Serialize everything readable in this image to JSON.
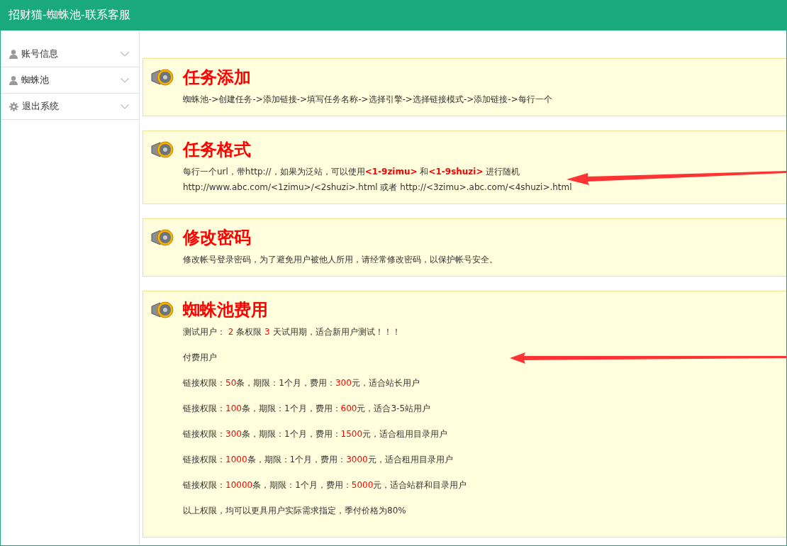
{
  "header": {
    "title": "招财猫-蜘蛛池-联系客服"
  },
  "sidebar": {
    "items": [
      {
        "label": "账号信息",
        "kind": "user",
        "expanded": false
      },
      {
        "label": "蜘蛛池",
        "kind": "user",
        "expanded": false
      },
      {
        "label": "退出系统",
        "kind": "gear",
        "expanded": false
      }
    ]
  },
  "notices": [
    {
      "title": "任务添加",
      "kind": "info",
      "paragraphs": [
        [
          {
            "text": "蜘蛛池->创建任务->添加链接->填写任务名称->选择引擎->选择链接模式->添加链接->每行一个",
            "kind": "plain"
          }
        ]
      ]
    },
    {
      "title": "任务格式",
      "kind": "info",
      "paragraphs": [
        [
          {
            "text": "每行一个url，带http://，如果为泛站，可以使用",
            "kind": "plain"
          },
          {
            "text": "<1-9zimu>",
            "kind": "strong"
          },
          {
            "text": " 和",
            "kind": "plain"
          },
          {
            "text": "<1-9shuzi>",
            "kind": "strong"
          },
          {
            "text": " 进行随机",
            "kind": "plain"
          }
        ],
        [
          {
            "text": "http://www.abc.com/<1zimu>/<2shuzi>.html 或者 http://<3zimu>.abc.com/<4shuzi>.html",
            "kind": "plain"
          }
        ]
      ]
    },
    {
      "title": "修改密码",
      "kind": "info",
      "paragraphs": [
        [
          {
            "text": "修改帐号登录密码，为了避免用户被他人所用，请经常修改密码，以保护帐号安全。",
            "kind": "plain"
          }
        ]
      ]
    },
    {
      "title": "蜘蛛池费用",
      "kind": "pricing",
      "paragraphs": [
        [
          {
            "text": "测试用户： ",
            "kind": "plain"
          },
          {
            "text": "2",
            "kind": "accent"
          },
          {
            "text": " 条权限 ",
            "kind": "plain"
          },
          {
            "text": "3",
            "kind": "accent"
          },
          {
            "text": " 天试用期，适合新用户测试！！！",
            "kind": "plain"
          }
        ],
        [
          {
            "text": "付费用户",
            "kind": "plain"
          }
        ],
        [
          {
            "text": "链接权限：",
            "kind": "plain"
          },
          {
            "text": "50",
            "kind": "accent"
          },
          {
            "text": "条，期限：1个月，费用：",
            "kind": "plain"
          },
          {
            "text": "300",
            "kind": "accent"
          },
          {
            "text": "元，适合站长用户",
            "kind": "plain"
          }
        ],
        [
          {
            "text": "链接权限：",
            "kind": "plain"
          },
          {
            "text": "100",
            "kind": "accent"
          },
          {
            "text": "条，期限：1个月，费用：",
            "kind": "plain"
          },
          {
            "text": "600",
            "kind": "accent"
          },
          {
            "text": "元，适合3-5站用户",
            "kind": "plain"
          }
        ],
        [
          {
            "text": "链接权限：",
            "kind": "plain"
          },
          {
            "text": "300",
            "kind": "accent"
          },
          {
            "text": "条，期限：1个月，费用：",
            "kind": "plain"
          },
          {
            "text": "1500",
            "kind": "accent"
          },
          {
            "text": "元，适合租用目录用户",
            "kind": "plain"
          }
        ],
        [
          {
            "text": "链接权限：",
            "kind": "plain"
          },
          {
            "text": "1000",
            "kind": "accent"
          },
          {
            "text": "条，期限：1个月，费用：",
            "kind": "plain"
          },
          {
            "text": "3000",
            "kind": "accent"
          },
          {
            "text": "元，适合租用目录用户",
            "kind": "plain"
          }
        ],
        [
          {
            "text": "链接权限：",
            "kind": "plain"
          },
          {
            "text": "10000",
            "kind": "accent"
          },
          {
            "text": "条，期限：1个月，费用：",
            "kind": "plain"
          },
          {
            "text": "5000",
            "kind": "accent"
          },
          {
            "text": "元，适合站群和目录用户",
            "kind": "plain"
          }
        ],
        [
          {
            "text": "以上权限，均可以更具用户实际需求指定，季付价格为80%",
            "kind": "plain"
          }
        ]
      ]
    }
  ]
}
